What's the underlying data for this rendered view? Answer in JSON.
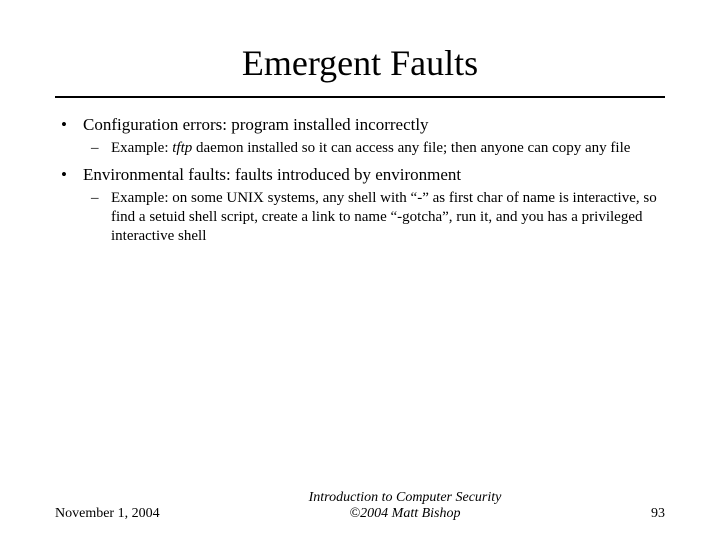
{
  "slide": {
    "title": "Emergent Faults",
    "bullets": [
      {
        "text": "Configuration errors: program installed incorrectly",
        "sub": [
          {
            "prefix": "Example: ",
            "italic": "tftp",
            "rest": " daemon installed so it can access any file; then anyone can copy any file"
          }
        ]
      },
      {
        "text": "Environmental faults: faults introduced by environment",
        "sub": [
          {
            "prefix": "",
            "italic": "",
            "rest": "Example: on some UNIX systems, any shell with “-” as first char of name is interactive, so find a setuid shell script, create a link to name “-gotcha”, run it, and you has a privileged interactive shell"
          }
        ]
      }
    ]
  },
  "footer": {
    "date": "November 1, 2004",
    "center_line1": "Introduction to Computer Security",
    "center_line2": "©2004 Matt Bishop",
    "page": "93"
  }
}
